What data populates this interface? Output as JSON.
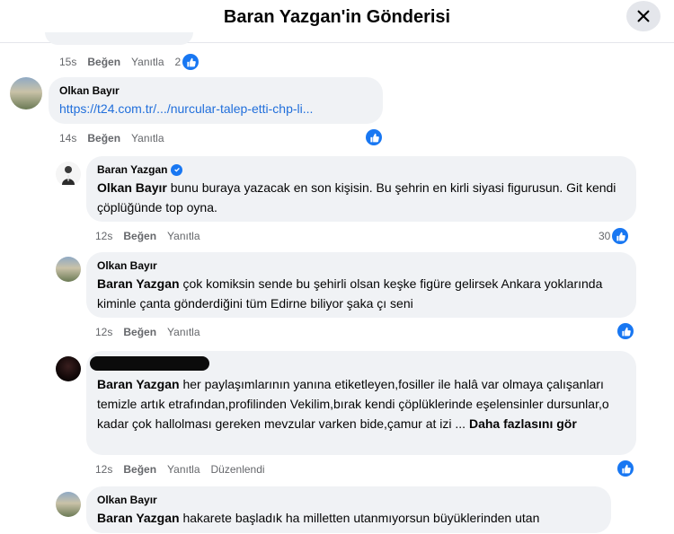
{
  "header": {
    "title": "Baran Yazgan'in Gönderisi"
  },
  "actions": {
    "like": "Beğen",
    "reply": "Yanıtla",
    "edited": "Düzenlendi"
  },
  "prev": {
    "time": "15s",
    "reactions": "2"
  },
  "comments": [
    {
      "author": "Olkan Bayır",
      "link": "https://t24.com.tr/.../nurcular-talep-etti-chp-li...",
      "time": "14s"
    },
    {
      "author": "Baran Yazgan",
      "verified": true,
      "mention": "Olkan Bayır",
      "text": " bunu buraya yazacak en son kişisin. Bu şehrin en kirli siyasi figurusun. Git kendi çöplüğünde top oyna.",
      "time": "12s",
      "reactions": "30"
    },
    {
      "author": "Olkan Bayır",
      "mention": "Baran Yazgan",
      "text": " çok komiksin sende bu şehirli olsan keşke figüre gelirsek Ankara yoklarında kiminle çanta gönderdiğini tüm Edirne biliyor şaka çı seni",
      "time": "12s"
    },
    {
      "mention": "Baran Yazgan",
      "text": " her paylaşımlarının yanına etiketleyen,fosiller ile halâ var olmaya çalışanları temizle artık etrafından,profilinden Vekilim,bırak kendi çöplüklerinde eşelensinler dursunlar,o kadar çok hallolması gereken mevzular varken bide,çamur at izi ... ",
      "see_more": "Daha fazlasını gör",
      "time": "12s"
    },
    {
      "author": "Olkan Bayır",
      "mention": "Baran Yazgan",
      "text": " hakarete başladık ha milletten utanmıyorsun büyüklerinden utan"
    }
  ],
  "icons": [
    "close-icon",
    "like-icon",
    "verified-icon"
  ],
  "colors": {
    "accent": "#1877f2",
    "link": "#216fdb",
    "bubble": "#f0f2f5",
    "meta": "#65676b"
  }
}
